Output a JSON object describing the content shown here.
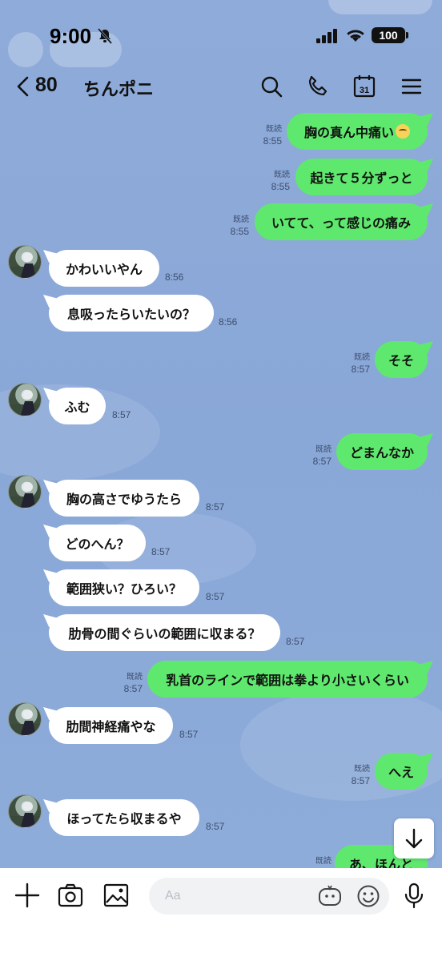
{
  "status_bar": {
    "time": "9:00",
    "battery": "100"
  },
  "header": {
    "unread_count": "80",
    "title": "ちんポニ"
  },
  "messages": [
    {
      "side": "out",
      "text": "胸の真ん中痛い",
      "emoji": "pleading-face-emoji",
      "read": "既読",
      "time": "8:55"
    },
    {
      "side": "out",
      "text": "起きて５分ずっと",
      "read": "既読",
      "time": "8:55"
    },
    {
      "side": "out",
      "text": "いてて、って感じの痛み",
      "read": "既読",
      "time": "8:55"
    },
    {
      "side": "in",
      "text": "かわいいやん",
      "time": "8:56"
    },
    {
      "side": "in",
      "text": "息吸ったらいたいの？",
      "time": "8:56"
    },
    {
      "side": "out",
      "text": "そそ",
      "read": "既読",
      "time": "8:57"
    },
    {
      "side": "in",
      "text": "ふむ",
      "time": "8:57"
    },
    {
      "side": "out",
      "text": "どまんなか",
      "read": "既読",
      "time": "8:57"
    },
    {
      "side": "in",
      "text": "胸の高さでゆうたら",
      "time": "8:57"
    },
    {
      "side": "in",
      "text": "どのへん？",
      "time": "8:57"
    },
    {
      "side": "in",
      "text": "範囲狭い？ひろい？",
      "time": "8:57"
    },
    {
      "side": "in",
      "text": "肋骨の間ぐらいの範囲に収まる？",
      "time": "8:57"
    },
    {
      "side": "out",
      "text": "乳首のラインで範囲は拳より小さいくらい",
      "read": "既読",
      "time": "8:57"
    },
    {
      "side": "in",
      "text": "肋間神経痛やな",
      "time": "8:57"
    },
    {
      "side": "out",
      "text": "へえ",
      "read": "既読",
      "time": "8:57"
    },
    {
      "side": "in",
      "text": "ほってたら収まるや",
      "time": "8:57"
    },
    {
      "side": "out",
      "text": "あ、ほんと",
      "read": "既読",
      "time": ""
    }
  ],
  "input": {
    "placeholder": "Aa"
  },
  "colors": {
    "background": "#8aa8d8",
    "outgoing_bubble": "#5fe86e",
    "incoming_bubble": "#ffffff"
  },
  "icons": {
    "header": [
      "search-icon",
      "phone-icon",
      "calendar-icon",
      "menu-icon"
    ],
    "input_bar": [
      "plus-icon",
      "camera-icon",
      "image-icon",
      "sticker-icon",
      "emoji-icon",
      "microphone-icon"
    ]
  }
}
